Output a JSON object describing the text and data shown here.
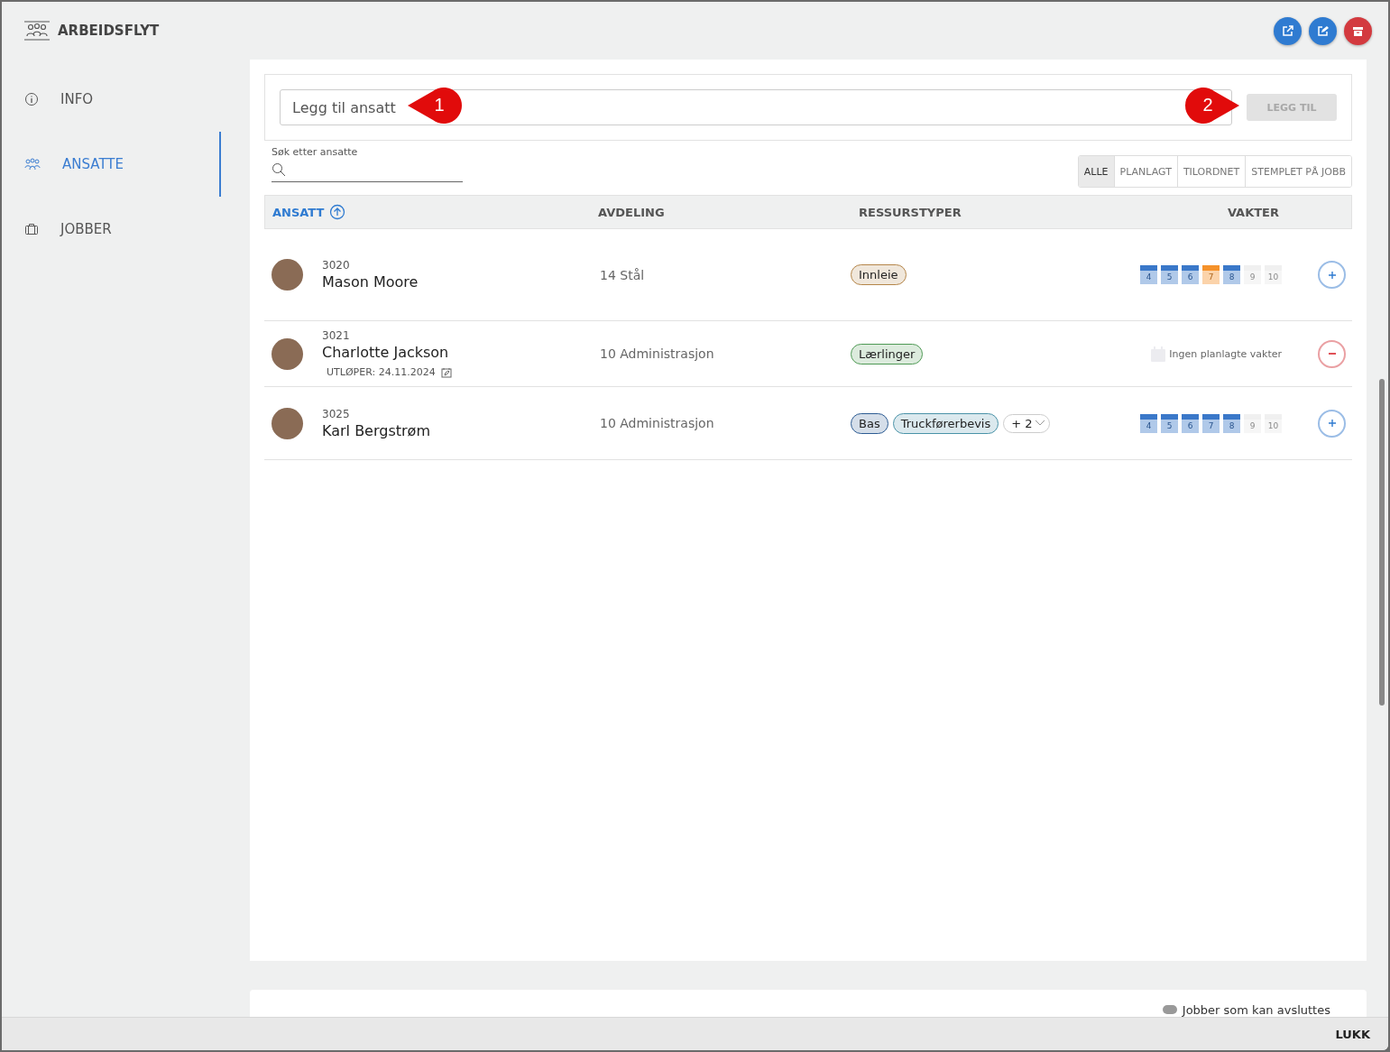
{
  "header": {
    "title": "ARBEIDSFLYT"
  },
  "toolbar_buttons": [
    {
      "kind": "open",
      "color": "#2f7bd1"
    },
    {
      "kind": "edit",
      "color": "#2f7bd1"
    },
    {
      "kind": "archive",
      "color": "#d33a3f"
    }
  ],
  "sidebar": {
    "items": [
      {
        "label": "INFO",
        "kind": "info",
        "selected": false
      },
      {
        "label": "ANSATTE",
        "kind": "people",
        "selected": true
      },
      {
        "label": "JOBBER",
        "kind": "jobs",
        "selected": false
      }
    ]
  },
  "add_employee": {
    "placeholder": "Legg til ansatt",
    "button": {
      "label": "LEGG TIL",
      "disabled": true
    }
  },
  "callouts": [
    {
      "label": "1",
      "kind": "left"
    },
    {
      "label": "2",
      "kind": "right"
    }
  ],
  "search": {
    "label": "Søk etter ansatte"
  },
  "filters": [
    {
      "label": "ALLE",
      "selected": true
    },
    {
      "label": "PLANLAGT",
      "selected": false
    },
    {
      "label": "TILORDNET",
      "selected": false
    },
    {
      "label": "STEMPLET PÅ JOBB",
      "selected": false
    }
  ],
  "table": {
    "columns": [
      {
        "label": "ANSATT",
        "sorted": true
      },
      {
        "label": "AVDELING",
        "sorted": false
      },
      {
        "label": "RESSURSTYPER",
        "sorted": false
      },
      {
        "label": "VAKTER",
        "sorted": false
      }
    ],
    "rows": [
      {
        "number": "3020",
        "name": "Mason Moore",
        "department": "14 Stål",
        "tags": [
          {
            "label": "Innleie",
            "color": "#b5864a"
          }
        ],
        "shifts": [
          {
            "day": "4",
            "color": "#3a78c9"
          },
          {
            "day": "5",
            "color": "#3a78c9"
          },
          {
            "day": "6",
            "color": "#3a78c9"
          },
          {
            "day": "7",
            "color": "#f5922b"
          },
          {
            "day": "8",
            "color": "#3a78c9"
          },
          {
            "day": "9",
            "color": "#e8e8e8"
          },
          {
            "day": "10",
            "color": "#e8e8e8"
          }
        ],
        "kind": "add"
      },
      {
        "number": "3021",
        "name": "Charlotte Jackson",
        "expires": "UTLØPER: 24.11.2024",
        "department": "10 Administrasjon",
        "tags": [
          {
            "label": "Lærlinger",
            "color": "#4f9a55"
          }
        ],
        "no_shifts": "Ingen planlagte vakter",
        "kind": "remove"
      },
      {
        "number": "3025",
        "name": "Karl Bergstrøm",
        "department": "10 Administrasjon",
        "tags": [
          {
            "label": "Bas",
            "color": "#2d5c93"
          },
          {
            "label": "Truckførerbevis",
            "color": "#4a93a8"
          }
        ],
        "more_tags": "+ 2",
        "shifts": [
          {
            "day": "4",
            "color": "#3a78c9"
          },
          {
            "day": "5",
            "color": "#3a78c9"
          },
          {
            "day": "6",
            "color": "#3a78c9"
          },
          {
            "day": "7",
            "color": "#3a78c9"
          },
          {
            "day": "8",
            "color": "#3a78c9"
          },
          {
            "day": "9",
            "color": "#e8e8e8"
          },
          {
            "day": "10",
            "color": "#e8e8e8"
          }
        ],
        "kind": "add"
      }
    ]
  },
  "lower_panel": {
    "label": "Jobber som kan avsluttes"
  },
  "footer": {
    "close_button": "LUKK"
  }
}
